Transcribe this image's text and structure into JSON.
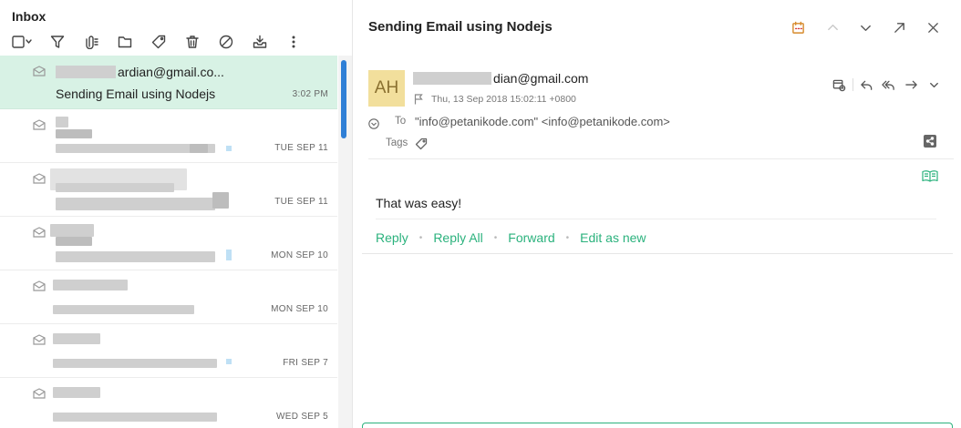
{
  "folder": {
    "title": "Inbox"
  },
  "toolbar": {
    "icons": [
      "select-all-checkbox-icon",
      "filter-icon",
      "attachments-icon",
      "move-to-folder-icon",
      "tag-icon",
      "delete-icon",
      "block-icon",
      "archive-icon",
      "more-icon"
    ]
  },
  "messages": [
    {
      "from_visible": "ardian@gmail.co...",
      "subject": "Sending Email using Nodejs",
      "date": "3:02 PM",
      "selected": true
    },
    {
      "date": "TUE SEP 11"
    },
    {
      "date": "TUE SEP 11"
    },
    {
      "date": "MON SEP 10"
    },
    {
      "date": "MON SEP 10"
    },
    {
      "date": "FRI SEP 7"
    },
    {
      "date": "WED SEP 5"
    }
  ],
  "viewer": {
    "subject": "Sending Email using Nodejs",
    "avatar_initials": "AH",
    "sender_visible": "dian@gmail.com",
    "datetime": "Thu, 13 Sep 2018 15:02:11 +0800",
    "to_label": "To",
    "to_value": "\"info@petanikode.com\" <info@petanikode.com>",
    "tags_label": "Tags",
    "body": "That was easy!",
    "actions": {
      "reply": "Reply",
      "reply_all": "Reply All",
      "forward": "Forward",
      "edit_as_new": "Edit as new"
    }
  },
  "colors": {
    "accent": "#2bb27d",
    "selected_row": "#d8f2e5",
    "avatar_bg": "#f2df9c",
    "scrollbar": "#2f7fd6"
  }
}
